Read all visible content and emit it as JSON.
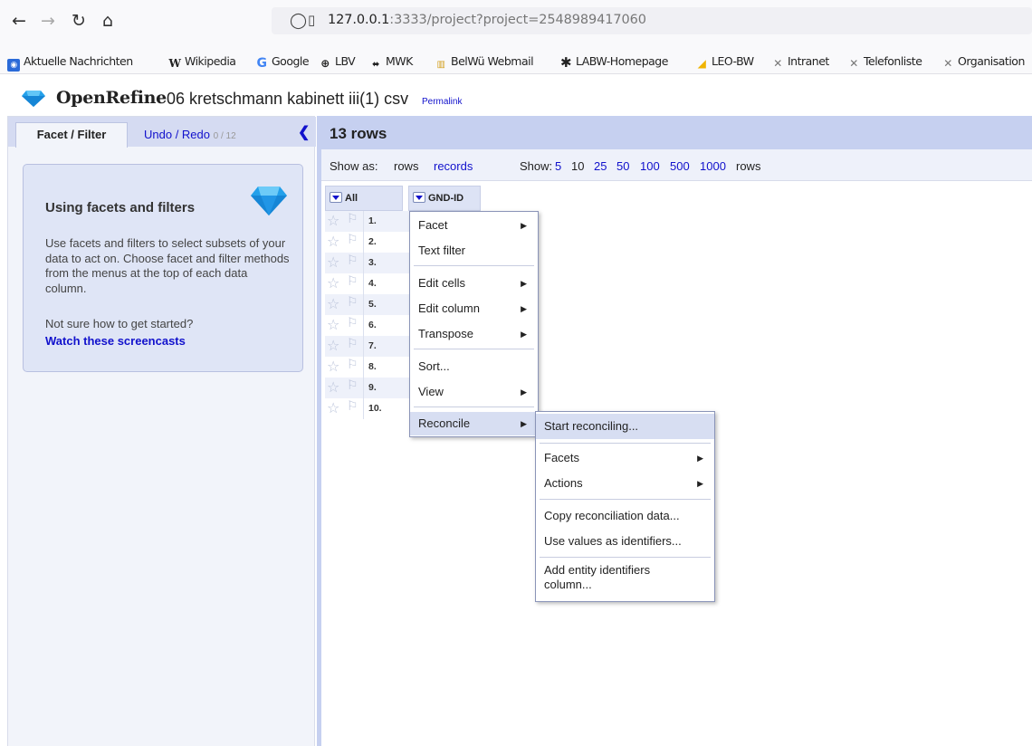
{
  "browser": {
    "url_host": "127.0.0.1",
    "url_rest": ":3333/project?project=2548989417060",
    "bookmarks": [
      "Aktuelle Nachrichten",
      "Wikipedia",
      "Google",
      "LBV",
      "MWK",
      "BelWü Webmail",
      "LABW-Homepage",
      "LEO-BW",
      "Intranet",
      "Telefonliste",
      "Organisation"
    ]
  },
  "header": {
    "logo": "OpenRefine",
    "project_title": "06 kretschmann kabinett iii(1) csv",
    "permalink": "Permalink"
  },
  "left": {
    "tab_facet": "Facet / Filter",
    "tab_undo": "Undo / Redo",
    "undo_count": "0 / 12",
    "help_title": "Using facets and filters",
    "help_text": "Use facets and filters to select subsets of your data to act on. Choose facet and filter methods from the menus at the top of each data column.",
    "help_question": "Not sure how to get started?",
    "help_link": "Watch these screencasts"
  },
  "main": {
    "rows_count": "13 rows",
    "show_as_label": "Show as:",
    "show_as_rows": "rows",
    "show_as_records": "records",
    "show_label": "Show:",
    "page_sizes": [
      "5",
      "10",
      "25",
      "50",
      "100",
      "500",
      "1000"
    ],
    "page_size_selected": "10",
    "rows_suffix": "rows",
    "col_all": "All",
    "col_gnd": "GND-ID",
    "row_numbers": [
      "1.",
      "2.",
      "3.",
      "4.",
      "5.",
      "6.",
      "7.",
      "8.",
      "9.",
      "10."
    ]
  },
  "column_menu": {
    "facet": "Facet",
    "text_filter": "Text filter",
    "edit_cells": "Edit cells",
    "edit_column": "Edit column",
    "transpose": "Transpose",
    "sort": "Sort...",
    "view": "View",
    "reconcile": "Reconcile"
  },
  "reconcile_menu": {
    "start": "Start reconciling...",
    "facets": "Facets",
    "actions": "Actions",
    "copy": "Copy reconciliation data...",
    "use_values": "Use values as identifiers...",
    "add_entity": "Add entity identifiers column..."
  },
  "colors": {
    "accent_link": "#1111cc",
    "header_band": "#c6d0f0",
    "menu_highlight": "#d7def2"
  }
}
